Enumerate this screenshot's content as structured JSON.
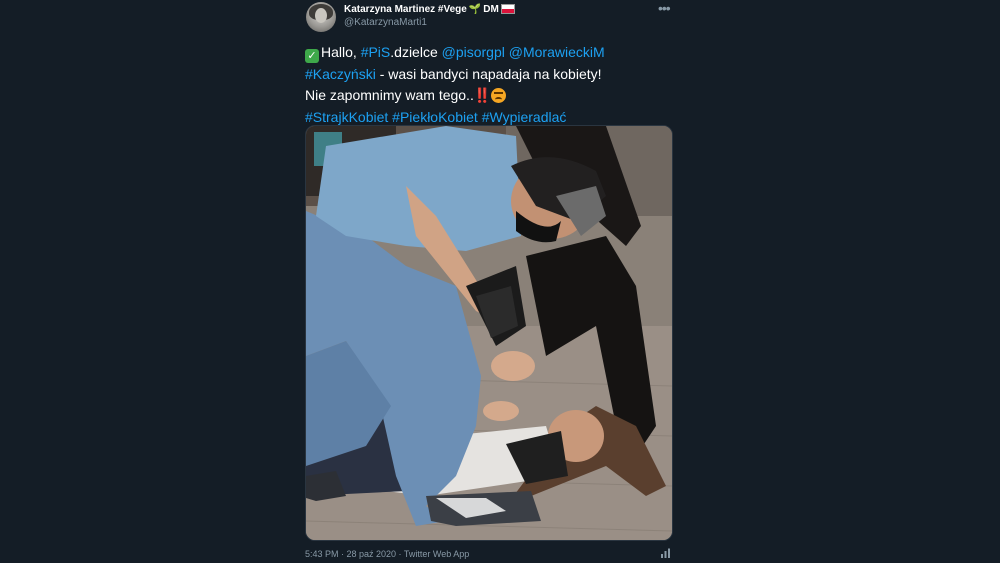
{
  "author": {
    "display_name": "Katarzyna Martinez #Vege",
    "display_suffix": "DM",
    "handle": "@KatarzynaMarti1"
  },
  "menu": {
    "more_label": "•••"
  },
  "tweet": {
    "line1": {
      "prefix": "Hallo, ",
      "tag_pis": "#PiS",
      "text_dzielce": ".dzielce ",
      "mention1": "@pisorgpl",
      "space": " ",
      "mention2": "@MorawieckiM"
    },
    "line2": {
      "tag_kaczynski": "#Kaczyński",
      "text": " - wasi bandyci napadaja na kobiety!"
    },
    "line3": {
      "text": "Nie zapomnimy wam tego..",
      "emphasis": "‼️"
    },
    "line4": {
      "tag1": "#StrajkKobiet",
      "tag2": "#PiekłoKobiet",
      "tag3": "#Wypieradlać"
    }
  },
  "meta": {
    "timestamp": "5:43 PM · 28 paź 2020 · Twitter Web App"
  },
  "colors": {
    "background": "#141d26",
    "link": "#1da1f2",
    "muted": "#8899a6"
  },
  "icons": [
    "check-mark-icon",
    "sprout-icon",
    "flag-icon",
    "angry-face-icon",
    "more-icon",
    "analytics-icon"
  ]
}
